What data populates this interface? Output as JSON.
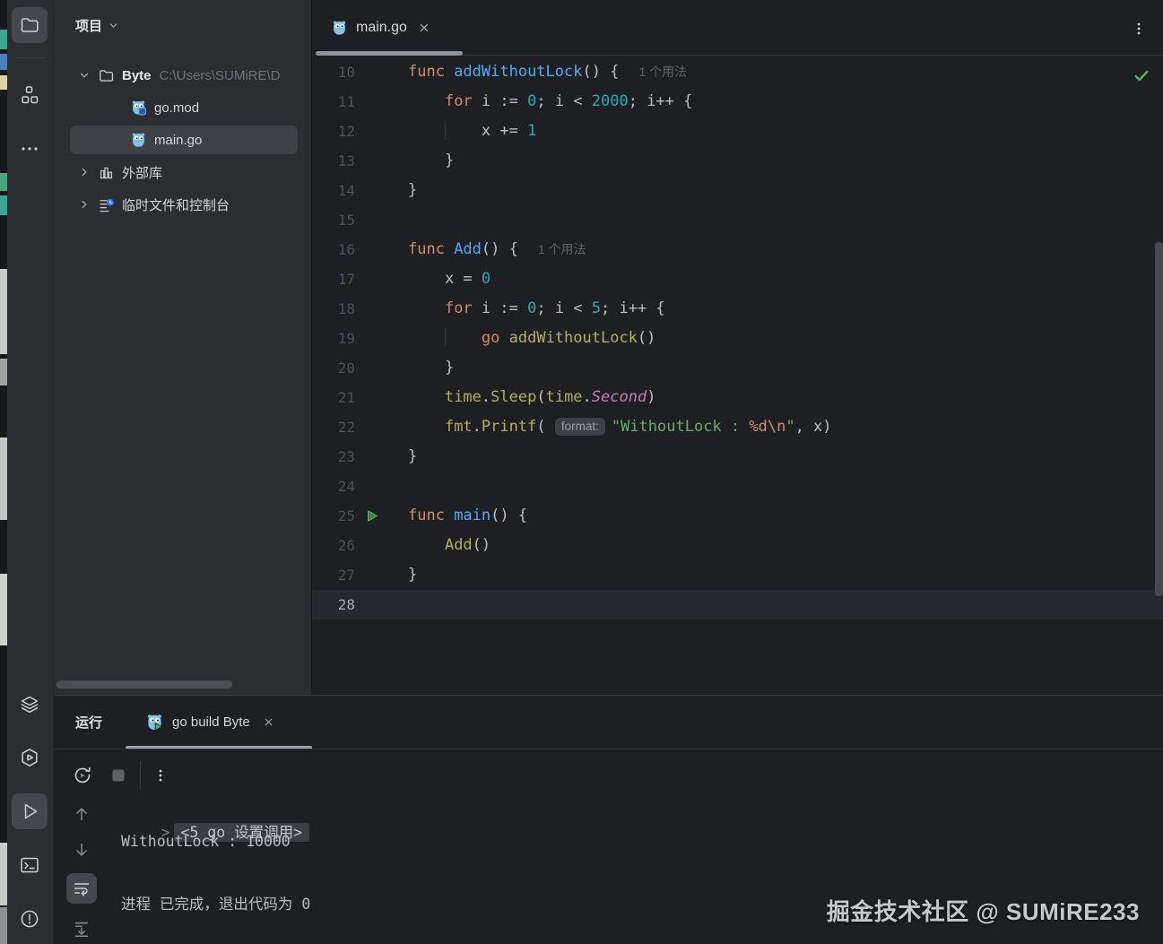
{
  "activity_bar": {
    "top": [
      {
        "icon": "project-folder",
        "selected": true
      },
      {
        "icon": "structure",
        "selected": false
      },
      {
        "icon": "more-tools",
        "selected": false
      }
    ],
    "bottom": [
      {
        "icon": "layers",
        "selected": false
      },
      {
        "icon": "services",
        "selected": false
      },
      {
        "icon": "run",
        "selected": true
      },
      {
        "icon": "terminal",
        "selected": false
      },
      {
        "icon": "problems",
        "selected": false
      }
    ]
  },
  "project_panel": {
    "title": "项目",
    "tree": [
      {
        "label": "Byte",
        "path": "C:\\Users\\SUMiRE\\D",
        "icon": "folder",
        "chev": "down",
        "indent": 0,
        "selected": false
      },
      {
        "label": "go.mod",
        "path": "",
        "icon": "gopher-mod",
        "chev": null,
        "indent": 1,
        "selected": false
      },
      {
        "label": "main.go",
        "path": "",
        "icon": "gopher",
        "chev": null,
        "indent": 1,
        "selected": true
      },
      {
        "label": "外部库",
        "path": "",
        "icon": "library",
        "chev": "right",
        "indent": 0,
        "selected": false
      },
      {
        "label": "临时文件和控制台",
        "path": "",
        "icon": "scratches",
        "chev": "right",
        "indent": 0,
        "selected": false
      }
    ]
  },
  "editor": {
    "tab": {
      "title": "main.go",
      "icon": "gopher",
      "close_icon": "close"
    },
    "menu_icon": "kebab",
    "status_icon": "inspections-ok",
    "current_line": 28,
    "lines": [
      {
        "n": 10,
        "segs": [
          [
            "func ",
            "kw"
          ],
          [
            "addWithoutLock",
            "fn"
          ],
          [
            "() {",
            ""
          ]
        ],
        "inlay": "1 个用法"
      },
      {
        "n": 11,
        "segs": [
          [
            "    ",
            "ind"
          ],
          [
            "for",
            "kw"
          ],
          [
            " i := ",
            ""
          ],
          [
            "0",
            "num"
          ],
          [
            "; i < ",
            ""
          ],
          [
            "2000",
            "num"
          ],
          [
            "; i++ {",
            ""
          ]
        ]
      },
      {
        "n": 12,
        "segs": [
          [
            "    ",
            "ind"
          ],
          [
            "    ",
            "g"
          ],
          [
            "x += ",
            ""
          ],
          [
            "1",
            "num"
          ]
        ]
      },
      {
        "n": 13,
        "segs": [
          [
            "    ",
            "ind"
          ],
          [
            "}",
            ""
          ]
        ]
      },
      {
        "n": 14,
        "segs": [
          [
            "}",
            ""
          ]
        ]
      },
      {
        "n": 15,
        "segs": []
      },
      {
        "n": 16,
        "segs": [
          [
            "func ",
            "kw"
          ],
          [
            "Add",
            "fn"
          ],
          [
            "() {",
            ""
          ]
        ],
        "inlay": "1 个用法"
      },
      {
        "n": 17,
        "segs": [
          [
            "    ",
            "ind"
          ],
          [
            "x = ",
            ""
          ],
          [
            "0",
            "num"
          ]
        ]
      },
      {
        "n": 18,
        "segs": [
          [
            "    ",
            "ind"
          ],
          [
            "for",
            "kw"
          ],
          [
            " i := ",
            ""
          ],
          [
            "0",
            "num"
          ],
          [
            "; i < ",
            ""
          ],
          [
            "5",
            "num"
          ],
          [
            "; i++ {",
            ""
          ]
        ]
      },
      {
        "n": 19,
        "segs": [
          [
            "    ",
            "ind"
          ],
          [
            "    ",
            "g"
          ],
          [
            "go ",
            "kw"
          ],
          [
            "addWithoutLock",
            "call"
          ],
          [
            "()",
            ""
          ]
        ]
      },
      {
        "n": 20,
        "segs": [
          [
            "    ",
            "ind"
          ],
          [
            "}",
            ""
          ]
        ]
      },
      {
        "n": 21,
        "segs": [
          [
            "    ",
            "ind"
          ],
          [
            "time",
            "call"
          ],
          [
            ".",
            ""
          ],
          [
            "Sleep",
            "call"
          ],
          [
            "(",
            ""
          ],
          [
            "time",
            "call"
          ],
          [
            ".",
            ""
          ],
          [
            "Second",
            "con"
          ],
          [
            ")",
            ""
          ]
        ]
      },
      {
        "n": 22,
        "segs": [
          [
            "    ",
            "ind"
          ],
          [
            "fmt",
            "call"
          ],
          [
            ".",
            ""
          ],
          [
            "Printf",
            "call"
          ],
          [
            "( ",
            ""
          ],
          [
            "format:",
            "hint"
          ],
          [
            "\"WithoutLock : ",
            "str"
          ],
          [
            "%d\\n",
            "esc"
          ],
          [
            "\"",
            "str"
          ],
          [
            ", x)",
            ""
          ]
        ]
      },
      {
        "n": 23,
        "segs": [
          [
            "}",
            ""
          ]
        ]
      },
      {
        "n": 24,
        "segs": []
      },
      {
        "n": 25,
        "segs": [
          [
            "func ",
            "kw"
          ],
          [
            "main",
            "fn"
          ],
          [
            "() {",
            ""
          ]
        ],
        "gutter": "run"
      },
      {
        "n": 26,
        "segs": [
          [
            "    ",
            "ind"
          ],
          [
            "Add",
            "call"
          ],
          [
            "()",
            ""
          ]
        ]
      },
      {
        "n": 27,
        "segs": [
          [
            "}",
            ""
          ]
        ]
      },
      {
        "n": 28,
        "segs": []
      }
    ]
  },
  "run_panel": {
    "label": "运行",
    "tab": {
      "title": "go build Byte",
      "icon": "gopher-run",
      "close_icon": "close"
    },
    "toolbar": [
      {
        "icon": "rerun",
        "enabled": true
      },
      {
        "icon": "stop",
        "enabled": false
      },
      {
        "icon": "kebab",
        "enabled": true
      }
    ],
    "rail": [
      {
        "icon": "arrow-up",
        "selected": false
      },
      {
        "icon": "arrow-down",
        "selected": false
      },
      {
        "icon": "soft-wrap",
        "selected": true
      },
      {
        "icon": "scroll-to-end",
        "selected": false
      }
    ],
    "console": {
      "prompt": ">",
      "folded": "<5 go 设置调用>",
      "output": "WithoutLock : 10000",
      "status": "进程 已完成，退出代码为 0"
    }
  },
  "watermark": "掘金技术社区 @ SUMiRE233",
  "colors": {
    "keyword": "#CF8E6D",
    "function_decl": "#56A8F5",
    "number": "#2AACB8",
    "call": "#B3AE60",
    "constant": "#C77DBB",
    "string": "#6AAB73",
    "format_spec": "#CF8E6D",
    "run_green": "#5FAD65",
    "selection_bg": "#3F4146",
    "editor_bg": "#1E1F22",
    "panel_bg": "#2B2D30"
  }
}
